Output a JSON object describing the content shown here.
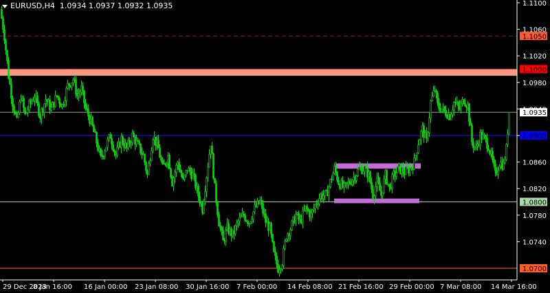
{
  "window": {
    "symbol": "EURUSD,H4",
    "quote": "1.0934 1.0937 1.0932 1.0935"
  },
  "chart_data": {
    "type": "candlestick",
    "symbol": "EURUSD",
    "timeframe": "H4",
    "ylim": [
      1.068,
      1.111
    ],
    "price_ticks": [
      "1.1100",
      "1.1060",
      "1.1020",
      "1.0980",
      "1.0940",
      "1.0900",
      "1.0860",
      "1.0820",
      "1.0780",
      "1.0740"
    ],
    "time_labels": [
      "29 Dec 2023",
      "8 Jan 16:00",
      "16 Jan 00:00",
      "23 Jan 08:00",
      "30 Jan 16:00",
      "7 Feb 00:00",
      "14 Feb 08:00",
      "21 Feb 16:00",
      "29 Feb 00:00",
      "7 Mar 08:00",
      "14 Mar 16:00"
    ],
    "close_path": [
      [
        0,
        1.109
      ],
      [
        6,
        1.105
      ],
      [
        12,
        1.099
      ],
      [
        18,
        1.095
      ],
      [
        24,
        1.092
      ],
      [
        30,
        1.096
      ],
      [
        36,
        1.093
      ],
      [
        42,
        1.0945
      ],
      [
        50,
        1.096
      ],
      [
        58,
        1.093
      ],
      [
        66,
        1.0955
      ],
      [
        74,
        1.094
      ],
      [
        82,
        1.096
      ],
      [
        90,
        1.0945
      ],
      [
        98,
        1.0975
      ],
      [
        106,
        1.0985
      ],
      [
        112,
        1.096
      ],
      [
        118,
        1.097
      ],
      [
        124,
        1.094
      ],
      [
        132,
        1.092
      ],
      [
        140,
        1.089
      ],
      [
        146,
        1.0865
      ],
      [
        152,
        1.088
      ],
      [
        160,
        1.09
      ],
      [
        168,
        1.087
      ],
      [
        176,
        1.0895
      ],
      [
        184,
        1.088
      ],
      [
        192,
        1.09
      ],
      [
        200,
        1.0885
      ],
      [
        208,
        1.087
      ],
      [
        214,
        1.084
      ],
      [
        222,
        1.09
      ],
      [
        230,
        1.088
      ],
      [
        236,
        1.085
      ],
      [
        244,
        1.087
      ],
      [
        250,
        1.083
      ],
      [
        258,
        1.086
      ],
      [
        266,
        1.083
      ],
      [
        272,
        1.085
      ],
      [
        280,
        1.084
      ],
      [
        288,
        1.081
      ],
      [
        294,
        1.079
      ],
      [
        300,
        1.084
      ],
      [
        306,
        1.089
      ],
      [
        312,
        1.082
      ],
      [
        318,
        1.077
      ],
      [
        324,
        1.074
      ],
      [
        330,
        1.076
      ],
      [
        338,
        1.075
      ],
      [
        346,
        1.077
      ],
      [
        354,
        1.078
      ],
      [
        362,
        1.077
      ],
      [
        370,
        1.079
      ],
      [
        378,
        1.08
      ],
      [
        386,
        1.077
      ],
      [
        392,
        1.076
      ],
      [
        398,
        1.072
      ],
      [
        404,
        1.07
      ],
      [
        410,
        1.071
      ],
      [
        416,
        1.075
      ],
      [
        422,
        1.076
      ],
      [
        430,
        1.078
      ],
      [
        436,
        1.077
      ],
      [
        444,
        1.079
      ],
      [
        452,
        1.078
      ],
      [
        460,
        1.08
      ],
      [
        466,
        1.081
      ],
      [
        474,
        1.081
      ],
      [
        480,
        1.083
      ],
      [
        486,
        1.085
      ],
      [
        492,
        1.083
      ],
      [
        500,
        1.082
      ],
      [
        508,
        1.083
      ],
      [
        516,
        1.084
      ],
      [
        522,
        1.085
      ],
      [
        530,
        1.085
      ],
      [
        536,
        1.084
      ],
      [
        542,
        1.081
      ],
      [
        548,
        1.083
      ],
      [
        554,
        1.081
      ],
      [
        560,
        1.084
      ],
      [
        566,
        1.082
      ],
      [
        572,
        1.084
      ],
      [
        580,
        1.085
      ],
      [
        588,
        1.0845
      ],
      [
        596,
        1.085
      ],
      [
        602,
        1.086
      ],
      [
        608,
        1.089
      ],
      [
        614,
        1.091
      ],
      [
        620,
        1.089
      ],
      [
        626,
        1.095
      ],
      [
        632,
        1.097
      ],
      [
        636,
        1.0945
      ],
      [
        642,
        1.094
      ],
      [
        648,
        1.0935
      ],
      [
        654,
        1.093
      ],
      [
        660,
        1.095
      ],
      [
        668,
        1.094
      ],
      [
        674,
        1.0955
      ],
      [
        680,
        1.0945
      ],
      [
        686,
        1.089
      ],
      [
        692,
        1.088
      ],
      [
        698,
        1.09
      ],
      [
        704,
        1.0895
      ],
      [
        710,
        1.0885
      ],
      [
        716,
        1.086
      ],
      [
        720,
        1.084
      ],
      [
        726,
        1.086
      ],
      [
        732,
        1.0855
      ],
      [
        736,
        1.088
      ],
      [
        740,
        1.0935
      ]
    ],
    "levels": [
      {
        "price": 1.105,
        "label": "1.1050",
        "color": "#8b1f1a",
        "style": "dashed",
        "label_bg": "#ff5a36"
      },
      {
        "price": 1.1,
        "label": "1.1000",
        "color": "#ff3030",
        "style": "zone",
        "zone_to": 1.099,
        "zone_color": "#f79a84",
        "label_bg": "#ff0000"
      },
      {
        "price": 1.0935,
        "label": "1.0935",
        "color": "#9aa79a",
        "style": "solid",
        "label_bg": "#ffffff",
        "label_fg": "#000000"
      },
      {
        "price": 1.09,
        "label": "1.0900",
        "color": "#1a1aff",
        "style": "solid",
        "label_bg": "#0000ff"
      },
      {
        "price": 1.08,
        "label": "1.0800",
        "color": "#9fd19f",
        "style": "solid",
        "label_bg": "#a8d8a8",
        "label_fg": "#000000"
      },
      {
        "price": 1.07,
        "label": "1.0700",
        "color": "#ff6a2a",
        "style": "solid",
        "label_bg": "#ff5a1f"
      }
    ],
    "rectangles": [
      {
        "x1": 488,
        "x2": 612,
        "y_top": 1.0858,
        "y_bottom": 1.085,
        "color": "#c46bd6"
      },
      {
        "x1": 486,
        "x2": 610,
        "y_top": 1.0805,
        "y_bottom": 1.0798,
        "color": "#c46bd6"
      }
    ],
    "colors": {
      "background": "#000000",
      "candle": "#00e000",
      "axis": "#ffffff"
    }
  }
}
